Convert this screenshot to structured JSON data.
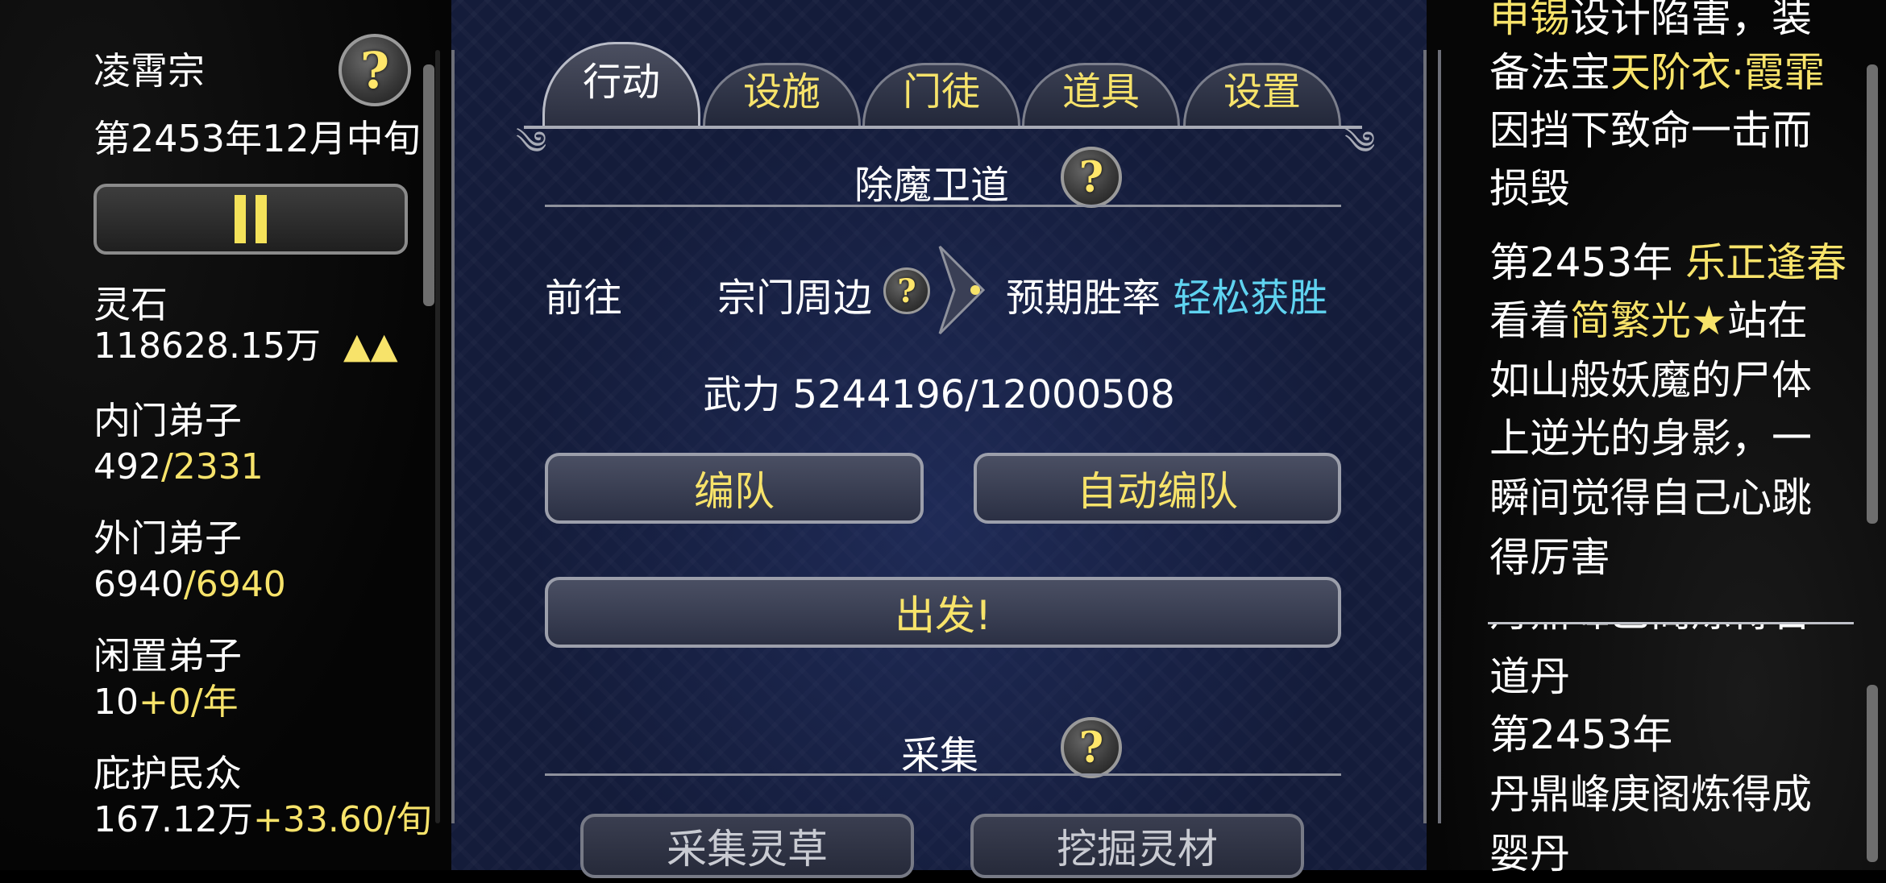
{
  "left": {
    "sect_name": "凌霄宗",
    "date": "第2453年12月中旬",
    "spirit_stone_label": "灵石",
    "spirit_stone_value": "118628.15万",
    "spirit_stone_trend": "▲▲",
    "inner_label": "内门弟子",
    "inner_current": "492",
    "inner_max": "/2331",
    "outer_label": "外门弟子",
    "outer_current": "6940",
    "outer_max": "/6940",
    "idle_label": "闲置弟子",
    "idle_current": "10",
    "idle_rate": "+0/年",
    "people_label": "庇护民众",
    "people_value": "167.12万",
    "people_rate": "+33.60/旬",
    "help": "?"
  },
  "tabs": [
    {
      "label": "行动",
      "active": true
    },
    {
      "label": "设施",
      "active": false
    },
    {
      "label": "门徒",
      "active": false
    },
    {
      "label": "道具",
      "active": false
    },
    {
      "label": "设置",
      "active": false
    }
  ],
  "mission": {
    "title": "除魔卫道",
    "go_label": "前往",
    "destination": "宗门周边",
    "win_rate_label": "预期胜率",
    "win_rate_value": "轻松获胜",
    "power": "武力 5244196/12000508",
    "formation_btn": "编队",
    "auto_formation_btn": "自动编队",
    "depart_btn": "出发!"
  },
  "gather": {
    "title": "采集",
    "herbs_btn": "采集灵草",
    "dig_btn": "挖掘灵材"
  },
  "log": {
    "l1a": "申锡",
    "l1b": "设计陷害，装",
    "l2a": "备法宝",
    "l2b": "天阶衣·霞霏",
    "l3": "因挡下致命一击而",
    "l4": "损毁",
    "l5a": "第2453年 ",
    "l5b": "乐正逢春",
    "l6a": "看着",
    "l6b": "简繁光★",
    "l6c": "站在",
    "l7": "如山般妖魔的尸体",
    "l8": "上逆光的身影，一",
    "l9": "瞬间觉得自己心跳",
    "l10": "得厉害",
    "l11": "丹鼎峰乙阁炼得合",
    "l12": "道丹",
    "l13": "第2453年",
    "l14": "丹鼎峰庚阁炼得成",
    "l15": "婴丹"
  },
  "colors": {
    "accent_yellow": "#f7e36a",
    "accent_cyan": "#5fd3f0",
    "panel_bg": "#141c3a"
  }
}
